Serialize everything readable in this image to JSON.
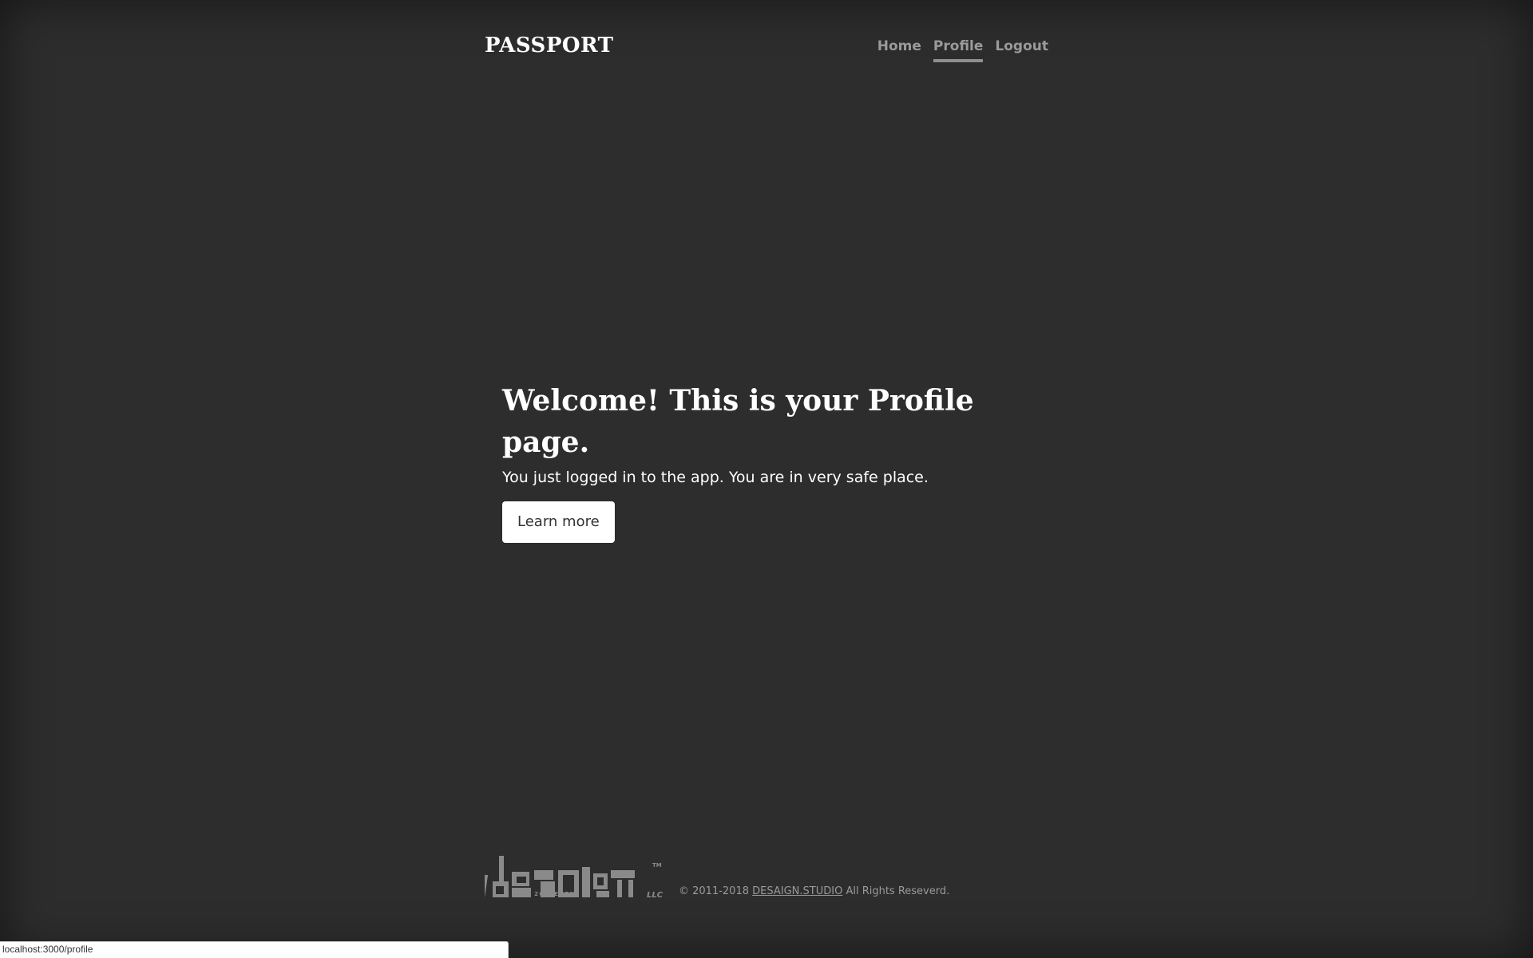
{
  "colors": {
    "background": "#2d2d2d",
    "nav_text": "#9a9a9a",
    "heading": "#ffffff",
    "button_bg": "#ffffff",
    "button_text": "#333333",
    "footer_text": "#9a9a9a"
  },
  "header": {
    "brand": "PASSPORT",
    "nav": [
      {
        "label": "Home",
        "active": false
      },
      {
        "label": "Profile",
        "active": true
      },
      {
        "label": "Logout",
        "active": false
      }
    ]
  },
  "hero": {
    "heading": "Welcome! This is your Profile page.",
    "subtext": "You just logged in to the app. You are in very safe place.",
    "button_label": "Learn more"
  },
  "footer": {
    "logo_text": "desaign",
    "logo_tagline": "EST. 20ELEVEN",
    "logo_tm": "TM",
    "logo_llc": "LLC",
    "copyright_prefix": "© 2011-2018",
    "link_text": "DESAIGN.STUDIO",
    "copyright_suffix": "All Rights Reseverd."
  },
  "status_bar": {
    "url": "localhost:3000/profile"
  }
}
